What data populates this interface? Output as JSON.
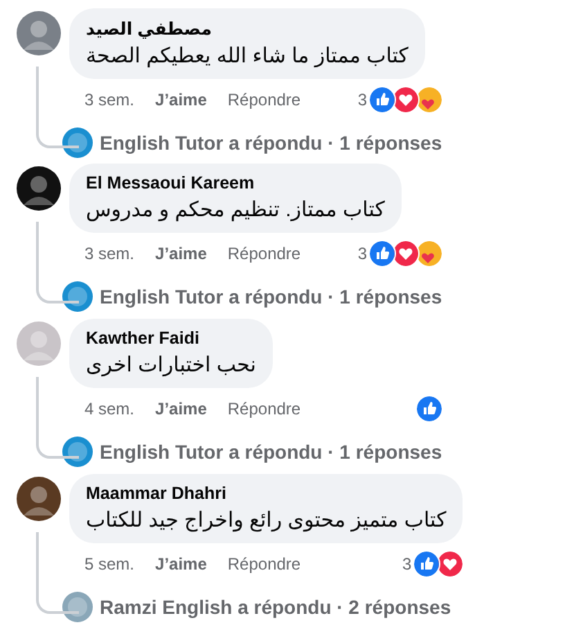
{
  "comments": [
    {
      "author": "مصطفي الصيد",
      "text": "كتاب ممتاز ما شاء الله يعطيكم الصحة",
      "time": "3 sem.",
      "like": "J’aime",
      "reply": "Répondre",
      "reaction_count": "3",
      "reactions": [
        {
          "kind": "like"
        },
        {
          "kind": "love"
        },
        {
          "kind": "care"
        }
      ],
      "replies": "English Tutor a répondu · 1 réponses"
    },
    {
      "author": "El Messaoui Kareem",
      "text": "كتاب ممتاز. تنظيم محكم و مدروس",
      "time": "3 sem.",
      "like": "J’aime",
      "reply": "Répondre",
      "reaction_count": "3",
      "reactions": [
        {
          "kind": "like"
        },
        {
          "kind": "love"
        },
        {
          "kind": "care"
        }
      ],
      "replies": "English Tutor a répondu · 1 réponses"
    },
    {
      "author": "Kawther Faidi",
      "text": "نحب اختبارات اخرى",
      "time": "4 sem.",
      "like": "J’aime",
      "reply": "Répondre",
      "reactions": [
        {
          "kind": "like"
        }
      ],
      "replies": "English Tutor a répondu · 1 réponses"
    },
    {
      "author": "Maammar Dhahri",
      "text": "كتاب متميز محتوى رائع واخراج جيد للكتاب",
      "time": "5 sem.",
      "like": "J’aime",
      "reply": "Répondre",
      "reaction_count": "3",
      "reactions": [
        {
          "kind": "like"
        },
        {
          "kind": "love"
        }
      ],
      "replies": "Ramzi English a répondu · 2 réponses"
    }
  ]
}
